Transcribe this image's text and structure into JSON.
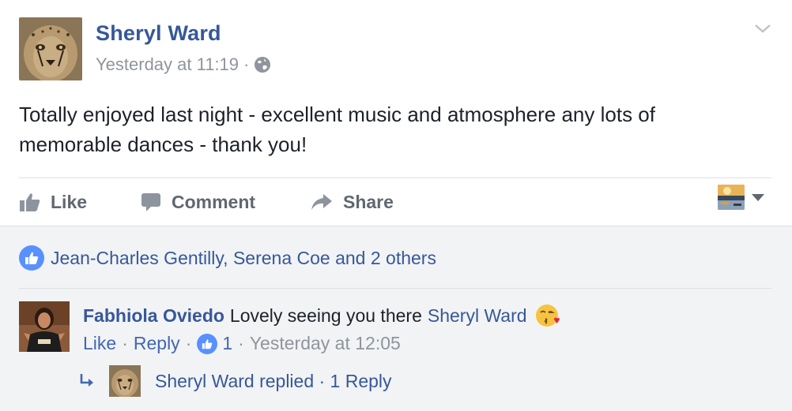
{
  "post": {
    "author": "Sheryl Ward",
    "timestamp": "Yesterday at 11:19",
    "separator": "·",
    "privacy_icon": "globe-icon",
    "text": "Totally enjoyed last night - excellent music and atmosphere any lots of memorable dances - thank you!"
  },
  "actions": {
    "like": "Like",
    "comment": "Comment",
    "share": "Share"
  },
  "reactions": {
    "summary": "Jean-Charles Gentilly, Serena Coe and 2 others"
  },
  "comment": {
    "author": "Fabhiola Oviedo",
    "text": "Lovely seeing you there",
    "mention": "Sheryl Ward",
    "emoji": "kissing-face-emoji",
    "like_label": "Like",
    "reply_label": "Reply",
    "like_count": "1",
    "timestamp": "Yesterday at 12:05",
    "sep": "·"
  },
  "reply_summary": {
    "text": "Sheryl Ward replied · 1 Reply"
  },
  "colors": {
    "link": "#365899",
    "muted": "#90949c",
    "like_blue": "#5890ff",
    "comment_bg": "#f2f3f5"
  }
}
